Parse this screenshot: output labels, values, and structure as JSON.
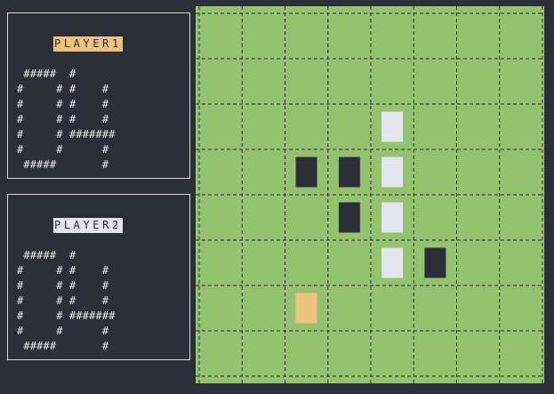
{
  "players": [
    {
      "label": "PLAYER1",
      "score_art": " #####  #\n#     # #    #\n#     # #    #\n#     # #    #\n#     # #######\n#     #      #\n #####       #"
    },
    {
      "label": "PLAYER2",
      "score_art": " #####  #\n#     # #    #\n#     # #    #\n#     # #    #\n#     # #######\n#     #      #\n #####       #"
    }
  ],
  "board": {
    "columns": 8,
    "rows": 8,
    "colors": {
      "background": "#95c26f",
      "grid_line": "#2b2f38",
      "dark_piece": "#2b2f38",
      "light_piece": "#e2e6ec",
      "cursor": "#eec17c"
    },
    "pieces": [
      {
        "row": 2,
        "col": 4,
        "color": "light"
      },
      {
        "row": 3,
        "col": 2,
        "color": "dark"
      },
      {
        "row": 3,
        "col": 3,
        "color": "dark"
      },
      {
        "row": 3,
        "col": 4,
        "color": "light"
      },
      {
        "row": 4,
        "col": 3,
        "color": "dark"
      },
      {
        "row": 4,
        "col": 4,
        "color": "light"
      },
      {
        "row": 5,
        "col": 4,
        "color": "light"
      },
      {
        "row": 5,
        "col": 5,
        "color": "dark"
      }
    ],
    "cursor": {
      "row": 6,
      "col": 2
    }
  }
}
